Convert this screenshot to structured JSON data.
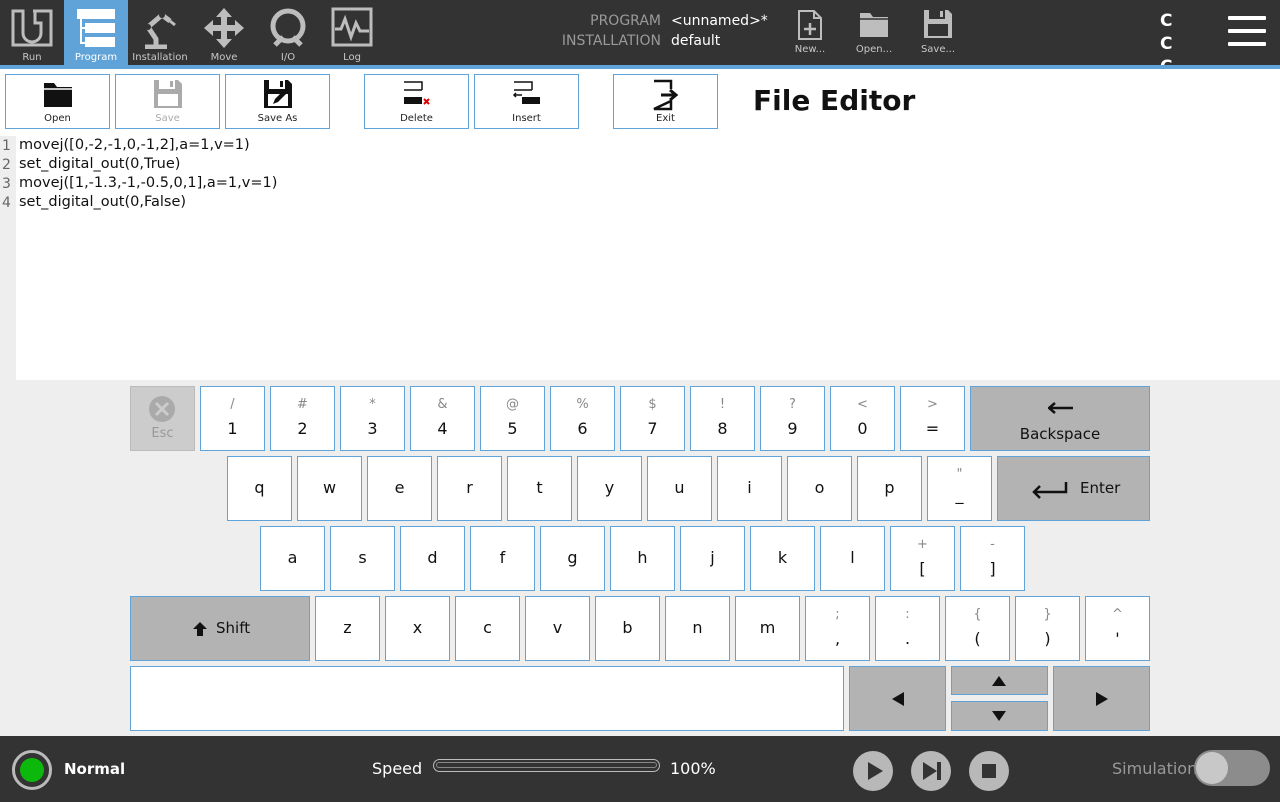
{
  "nav": {
    "items": [
      {
        "label": "Run",
        "icon": "ur-logo-icon",
        "active": false
      },
      {
        "label": "Program",
        "icon": "program-tree-icon",
        "active": true
      },
      {
        "label": "Installation",
        "icon": "robot-arm-icon",
        "active": false
      },
      {
        "label": "Move",
        "icon": "move-arrows-icon",
        "active": false
      },
      {
        "label": "I/O",
        "icon": "io-icon",
        "active": false
      },
      {
        "label": "Log",
        "icon": "log-chart-icon",
        "active": false
      }
    ]
  },
  "program_info": {
    "program_label": "PROGRAM",
    "program_value": "<unnamed>*",
    "installation_label": "INSTALLATION",
    "installation_value": "default"
  },
  "file_actions": {
    "new_label": "New...",
    "open_label": "Open...",
    "save_label": "Save..."
  },
  "toolbar": {
    "open_label": "Open",
    "save_label": "Save",
    "save_as_label": "Save As",
    "delete_label": "Delete",
    "insert_label": "Insert",
    "exit_label": "Exit",
    "title": "File Editor"
  },
  "editor": {
    "lines": [
      {
        "number": "1",
        "code": "movej([0,-2,-1,0,-1,2],a=1,v=1)"
      },
      {
        "number": "2",
        "code": "set_digital_out(0,True)"
      },
      {
        "number": "3",
        "code": "movej([1,-1.3,-1,-0.5,0,1],a=1,v=1)"
      },
      {
        "number": "4",
        "code": "set_digital_out(0,False)"
      }
    ]
  },
  "keyboard": {
    "esc_label": "Esc",
    "backspace_label": "Backspace",
    "enter_label": "Enter",
    "shift_label": "Shift",
    "row1": [
      {
        "alt": "/",
        "main": "1"
      },
      {
        "alt": "#",
        "main": "2"
      },
      {
        "alt": "*",
        "main": "3"
      },
      {
        "alt": "&",
        "main": "4"
      },
      {
        "alt": "@",
        "main": "5"
      },
      {
        "alt": "%",
        "main": "6"
      },
      {
        "alt": "$",
        "main": "7"
      },
      {
        "alt": "!",
        "main": "8"
      },
      {
        "alt": "?",
        "main": "9"
      },
      {
        "alt": "<",
        "main": "0"
      },
      {
        "alt": ">",
        "main": "="
      }
    ],
    "row2": [
      {
        "main": "q"
      },
      {
        "main": "w"
      },
      {
        "main": "e"
      },
      {
        "main": "r"
      },
      {
        "main": "t"
      },
      {
        "main": "y"
      },
      {
        "main": "u"
      },
      {
        "main": "i"
      },
      {
        "main": "o"
      },
      {
        "main": "p"
      },
      {
        "alt": "\"",
        "main": "_"
      }
    ],
    "row3": [
      {
        "main": "a"
      },
      {
        "main": "s"
      },
      {
        "main": "d"
      },
      {
        "main": "f"
      },
      {
        "main": "g"
      },
      {
        "main": "h"
      },
      {
        "main": "j"
      },
      {
        "main": "k"
      },
      {
        "main": "l"
      },
      {
        "alt": "+",
        "main": "["
      },
      {
        "alt": "-",
        "main": "]"
      }
    ],
    "row4": [
      {
        "main": "z"
      },
      {
        "main": "x"
      },
      {
        "main": "c"
      },
      {
        "main": "v"
      },
      {
        "main": "b"
      },
      {
        "main": "n"
      },
      {
        "main": "m"
      },
      {
        "alt": ";",
        "main": ","
      },
      {
        "alt": ":",
        "main": "."
      },
      {
        "alt": "{",
        "main": "("
      },
      {
        "alt": "}",
        "main": ")"
      },
      {
        "alt": "^",
        "main": "'"
      }
    ],
    "input_value": ""
  },
  "status": {
    "state_label": "Normal",
    "speed_label": "Speed",
    "speed_value": "100%",
    "speed_fraction": 1.0,
    "simulation_label": "Simulation",
    "simulation_on": false
  },
  "colors": {
    "accent": "#5fa3d9",
    "status_green": "#0db80d",
    "bar_dark": "#333333"
  }
}
